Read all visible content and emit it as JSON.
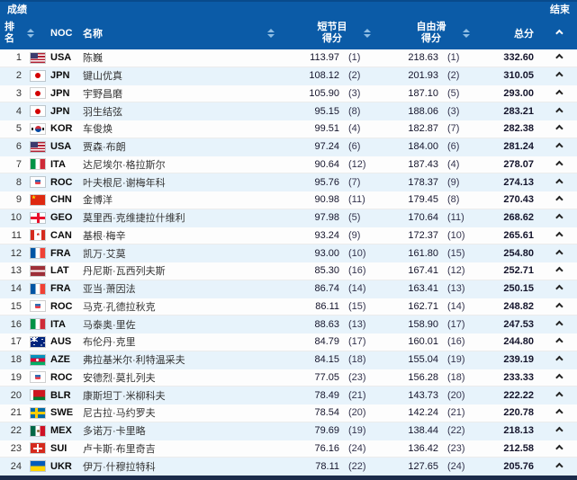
{
  "title_bar": {
    "left": "成绩",
    "right": "结束"
  },
  "columns": {
    "rank": "排\n名",
    "noc": "NOC",
    "name": "名称",
    "short_program": "短节目\n得分",
    "free_skate": "自由滑\n得分",
    "total": "总分"
  },
  "icons": {
    "sort": "sort-arrows",
    "expand": "chevron-up"
  },
  "colors": {
    "header_blue": "#0b5ba7",
    "row_alt_blue": "#e7f3fb",
    "sort_arrow": "#8ebde4",
    "bottom_bar": "#1c2b4a"
  },
  "rows": [
    {
      "rank": "1",
      "noc": "USA",
      "name": "陈巍",
      "sp": "113.97",
      "sp_rank": "(1)",
      "fs": "218.63",
      "fs_rank": "(1)",
      "total": "332.60"
    },
    {
      "rank": "2",
      "noc": "JPN",
      "name": "键山优真",
      "sp": "108.12",
      "sp_rank": "(2)",
      "fs": "201.93",
      "fs_rank": "(2)",
      "total": "310.05"
    },
    {
      "rank": "3",
      "noc": "JPN",
      "name": "宇野昌磨",
      "sp": "105.90",
      "sp_rank": "(3)",
      "fs": "187.10",
      "fs_rank": "(5)",
      "total": "293.00"
    },
    {
      "rank": "4",
      "noc": "JPN",
      "name": "羽生结弦",
      "sp": "95.15",
      "sp_rank": "(8)",
      "fs": "188.06",
      "fs_rank": "(3)",
      "total": "283.21"
    },
    {
      "rank": "5",
      "noc": "KOR",
      "name": "车俊焕",
      "sp": "99.51",
      "sp_rank": "(4)",
      "fs": "182.87",
      "fs_rank": "(7)",
      "total": "282.38"
    },
    {
      "rank": "6",
      "noc": "USA",
      "name": "贾森·布朗",
      "sp": "97.24",
      "sp_rank": "(6)",
      "fs": "184.00",
      "fs_rank": "(6)",
      "total": "281.24"
    },
    {
      "rank": "7",
      "noc": "ITA",
      "name": "达尼埃尔·格拉斯尔",
      "sp": "90.64",
      "sp_rank": "(12)",
      "fs": "187.43",
      "fs_rank": "(4)",
      "total": "278.07"
    },
    {
      "rank": "8",
      "noc": "ROC",
      "name": "叶夫根尼·谢梅年科",
      "sp": "95.76",
      "sp_rank": "(7)",
      "fs": "178.37",
      "fs_rank": "(9)",
      "total": "274.13"
    },
    {
      "rank": "9",
      "noc": "CHN",
      "name": "金博洋",
      "sp": "90.98",
      "sp_rank": "(11)",
      "fs": "179.45",
      "fs_rank": "(8)",
      "total": "270.43"
    },
    {
      "rank": "10",
      "noc": "GEO",
      "name": "莫里西·克维捷拉什维利",
      "sp": "97.98",
      "sp_rank": "(5)",
      "fs": "170.64",
      "fs_rank": "(11)",
      "total": "268.62"
    },
    {
      "rank": "11",
      "noc": "CAN",
      "name": "基根·梅辛",
      "sp": "93.24",
      "sp_rank": "(9)",
      "fs": "172.37",
      "fs_rank": "(10)",
      "total": "265.61"
    },
    {
      "rank": "12",
      "noc": "FRA",
      "name": "凯万·艾莫",
      "sp": "93.00",
      "sp_rank": "(10)",
      "fs": "161.80",
      "fs_rank": "(15)",
      "total": "254.80"
    },
    {
      "rank": "13",
      "noc": "LAT",
      "name": "丹尼斯·瓦西列夫斯",
      "sp": "85.30",
      "sp_rank": "(16)",
      "fs": "167.41",
      "fs_rank": "(12)",
      "total": "252.71"
    },
    {
      "rank": "14",
      "noc": "FRA",
      "name": "亚当·萧因法",
      "sp": "86.74",
      "sp_rank": "(14)",
      "fs": "163.41",
      "fs_rank": "(13)",
      "total": "250.15"
    },
    {
      "rank": "15",
      "noc": "ROC",
      "name": "马克·孔德拉秋克",
      "sp": "86.11",
      "sp_rank": "(15)",
      "fs": "162.71",
      "fs_rank": "(14)",
      "total": "248.82"
    },
    {
      "rank": "16",
      "noc": "ITA",
      "name": "马泰奥·里佐",
      "sp": "88.63",
      "sp_rank": "(13)",
      "fs": "158.90",
      "fs_rank": "(17)",
      "total": "247.53"
    },
    {
      "rank": "17",
      "noc": "AUS",
      "name": "布伦丹·克里",
      "sp": "84.79",
      "sp_rank": "(17)",
      "fs": "160.01",
      "fs_rank": "(16)",
      "total": "244.80"
    },
    {
      "rank": "18",
      "noc": "AZE",
      "name": "弗拉基米尔·利特温采夫",
      "sp": "84.15",
      "sp_rank": "(18)",
      "fs": "155.04",
      "fs_rank": "(19)",
      "total": "239.19"
    },
    {
      "rank": "19",
      "noc": "ROC",
      "name": "安德烈·莫扎列夫",
      "sp": "77.05",
      "sp_rank": "(23)",
      "fs": "156.28",
      "fs_rank": "(18)",
      "total": "233.33"
    },
    {
      "rank": "20",
      "noc": "BLR",
      "name": "康斯坦丁·米柳科夫",
      "sp": "78.49",
      "sp_rank": "(21)",
      "fs": "143.73",
      "fs_rank": "(20)",
      "total": "222.22"
    },
    {
      "rank": "21",
      "noc": "SWE",
      "name": "尼古拉·马约罗夫",
      "sp": "78.54",
      "sp_rank": "(20)",
      "fs": "142.24",
      "fs_rank": "(21)",
      "total": "220.78"
    },
    {
      "rank": "22",
      "noc": "MEX",
      "name": "多诺万·卡里略",
      "sp": "79.69",
      "sp_rank": "(19)",
      "fs": "138.44",
      "fs_rank": "(22)",
      "total": "218.13"
    },
    {
      "rank": "23",
      "noc": "SUI",
      "name": "卢卡斯·布里奇吉",
      "sp": "76.16",
      "sp_rank": "(24)",
      "fs": "136.42",
      "fs_rank": "(23)",
      "total": "212.58"
    },
    {
      "rank": "24",
      "noc": "UKR",
      "name": "伊万·什穆拉特科",
      "sp": "78.11",
      "sp_rank": "(22)",
      "fs": "127.65",
      "fs_rank": "(24)",
      "total": "205.76"
    }
  ]
}
